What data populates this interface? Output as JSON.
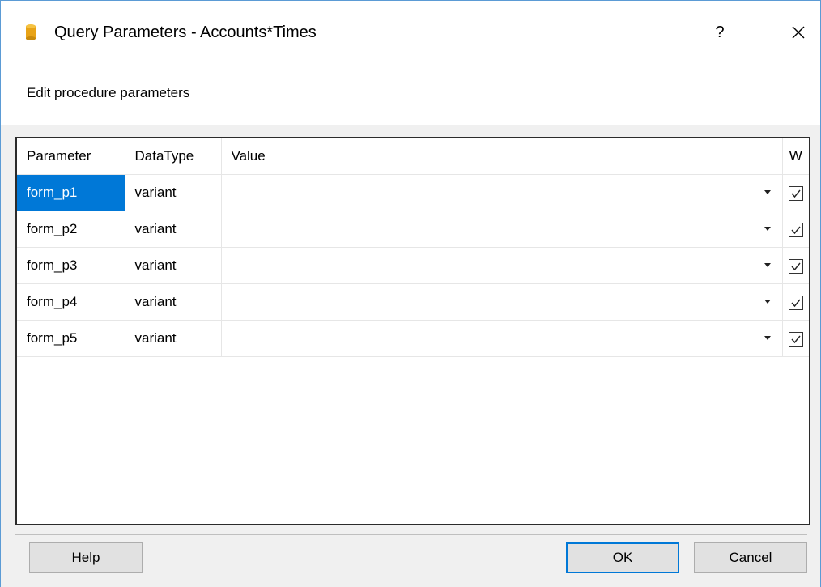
{
  "window": {
    "title": "Query Parameters - Accounts*Times",
    "help_glyph": "?",
    "icon": "database-icon",
    "accent": "#5b9bd5"
  },
  "subtitle": "Edit procedure parameters",
  "grid": {
    "columns": [
      "Parameter",
      "DataType",
      "Value",
      "W"
    ],
    "rows": [
      {
        "parameter": "form_p1",
        "datatype": "variant",
        "value": "",
        "w": true,
        "selected": true
      },
      {
        "parameter": "form_p2",
        "datatype": "variant",
        "value": "",
        "w": true,
        "selected": false
      },
      {
        "parameter": "form_p3",
        "datatype": "variant",
        "value": "",
        "w": true,
        "selected": false
      },
      {
        "parameter": "form_p4",
        "datatype": "variant",
        "value": "",
        "w": true,
        "selected": false
      },
      {
        "parameter": "form_p5",
        "datatype": "variant",
        "value": "",
        "w": true,
        "selected": false
      }
    ],
    "selection_color": "#0078d7"
  },
  "buttons": {
    "help": "Help",
    "ok": "OK",
    "cancel": "Cancel"
  }
}
